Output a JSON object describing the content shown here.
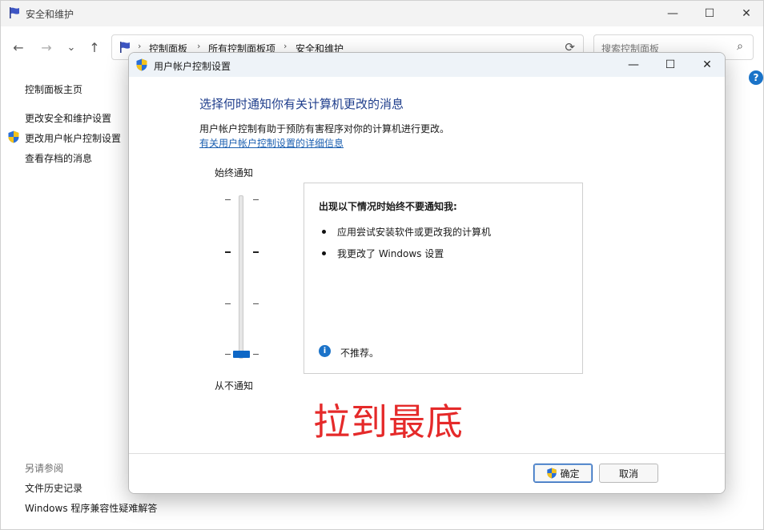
{
  "background_window": {
    "title": "安全和维护",
    "controls": {
      "minimize": "—",
      "maximize": "☐",
      "close": "✕"
    },
    "nav": {
      "back": "←",
      "forward": "→",
      "recent": "⌄",
      "up": "↑"
    },
    "breadcrumb": [
      "控制面板",
      "所有控制面板项",
      "安全和维护"
    ],
    "breadcrumb_sep": "›",
    "search_placeholder": "搜索控制面板",
    "sidebar": {
      "home": "控制面板主页",
      "items": [
        "更改安全和维护设置",
        "更改用户帐户控制设置",
        "查看存档的消息"
      ],
      "see_also_title": "另请参阅",
      "see_also": [
        "文件历史记录",
        "Windows 程序兼容性疑难解答"
      ]
    },
    "help_label": "?"
  },
  "dialog": {
    "title": "用户帐户控制设置",
    "controls": {
      "minimize": "—",
      "maximize": "☐",
      "close": "✕"
    },
    "heading": "选择何时通知你有关计算机更改的消息",
    "description": "用户帐户控制有助于预防有害程序对你的计算机进行更改。",
    "link": "有关用户帐户控制设置的详细信息",
    "slider": {
      "top_label": "始终通知",
      "bottom_label": "从不通知",
      "levels": 4,
      "selected_level": 0
    },
    "info": {
      "title": "出现以下情况时始终不要通知我:",
      "bullets": [
        "应用尝试安装软件或更改我的计算机",
        "我更改了 Windows 设置"
      ],
      "note_icon": "i",
      "note": "不推荐。"
    },
    "annotation": "拉到最底",
    "buttons": {
      "ok": "确定",
      "cancel": "取消"
    }
  },
  "colors": {
    "accent": "#0e67c6",
    "heading": "#1f3e8c",
    "link": "#1b5fb0",
    "annotation": "#e52a2a"
  }
}
